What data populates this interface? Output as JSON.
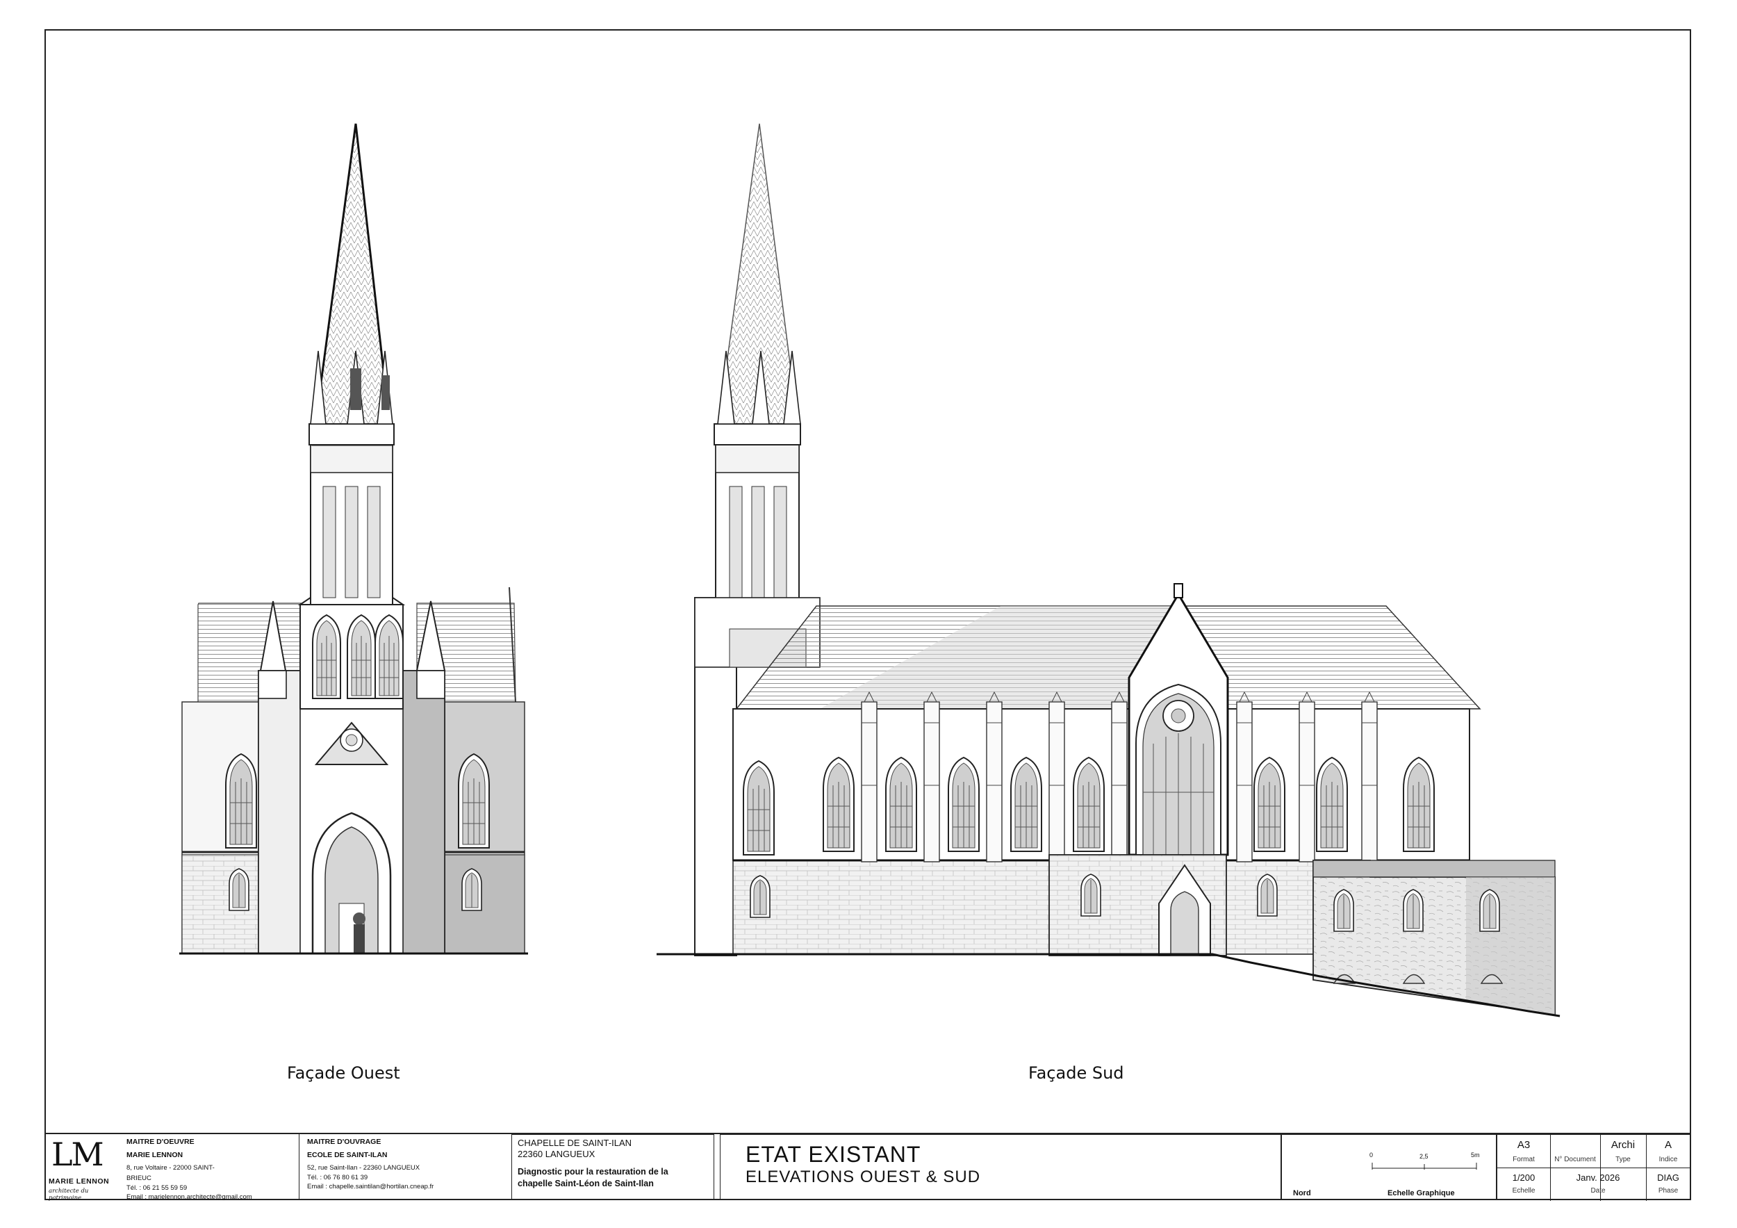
{
  "drawings": {
    "west_caption": "Façade Ouest",
    "south_caption": "Façade Sud"
  },
  "title_block": {
    "logo": {
      "monogram": "LM",
      "name": "MARIE LENNON",
      "tagline": "architecte du patrimoine"
    },
    "maitre_oeuvre": {
      "heading": "MAITRE D'OEUVRE",
      "name": "MARIE LENNON",
      "address": "8, rue Voltaire - 22000 SAINT-BRIEUC",
      "phone": "Tél. : 06 21 55 59 59",
      "email": "Email : marielennon.architecte@gmail.com"
    },
    "maitre_ouvrage": {
      "heading": "MAITRE D'OUVRAGE",
      "name": "ECOLE DE SAINT-ILAN",
      "address": "52, rue Saint-Ilan - 22360 LANGUEUX",
      "phone": "Tél. : 06 76 80 61 39",
      "email": "Email : chapelle.saintilan@hortilan.cneap.fr"
    },
    "project": {
      "name": "CHAPELLE DE SAINT-ILAN",
      "city": "22360 LANGUEUX",
      "desc1": "Diagnostic pour la restauration de la",
      "desc2": "chapelle Saint-Léon de Saint-Ilan"
    },
    "sheet_title": {
      "line1": "ETAT EXISTANT",
      "line2": "ELEVATIONS OUEST & SUD"
    },
    "scale_bar": {
      "t0": "0",
      "t1": "2,5",
      "t2": "5m",
      "north_label": "Nord",
      "scale_label": "Echelle Graphique"
    },
    "meta": {
      "format_value": "A3",
      "format_label": "Format",
      "doc_value": "",
      "doc_label": "N° Document",
      "type_value": "Archi",
      "type_label": "Type",
      "indice_value": "A",
      "indice_label": "Indice",
      "echelle_value": "1/200",
      "echelle_label": "Echelle",
      "date_value": "Janv. 2026",
      "date_label": "Date",
      "phase_value": "DIAG",
      "phase_label": "Phase"
    }
  }
}
